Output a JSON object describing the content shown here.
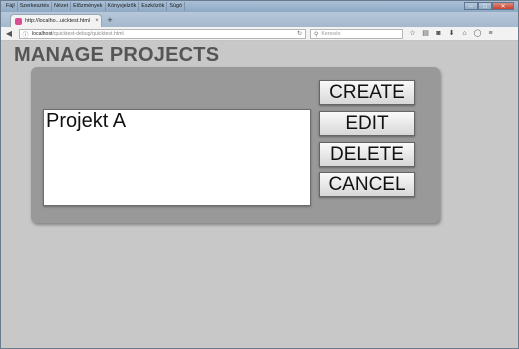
{
  "browser": {
    "menu": [
      "Fájl",
      "Szerkesztés",
      "Nézet",
      "Előzmények",
      "Könyvjelzők",
      "Eszközök",
      "Súgó"
    ],
    "tab_title": "http://localho...uicktest.html",
    "tab_close": "×",
    "new_tab": "+",
    "url_host": "localhost",
    "url_path": "/quicktest-debug/quicktest.html",
    "search_placeholder": "Keresés"
  },
  "page": {
    "title": "MANAGE PROJECTS",
    "projects": [
      "Projekt A"
    ],
    "buttons": {
      "create": "CREATE",
      "edit": "EDIT",
      "delete": "DELETE",
      "cancel": "CANCEL"
    }
  },
  "colors": {
    "background": "#c8c8c8",
    "panel": "#999999",
    "title": "#555555",
    "tab_favicon": "#d94f91"
  }
}
